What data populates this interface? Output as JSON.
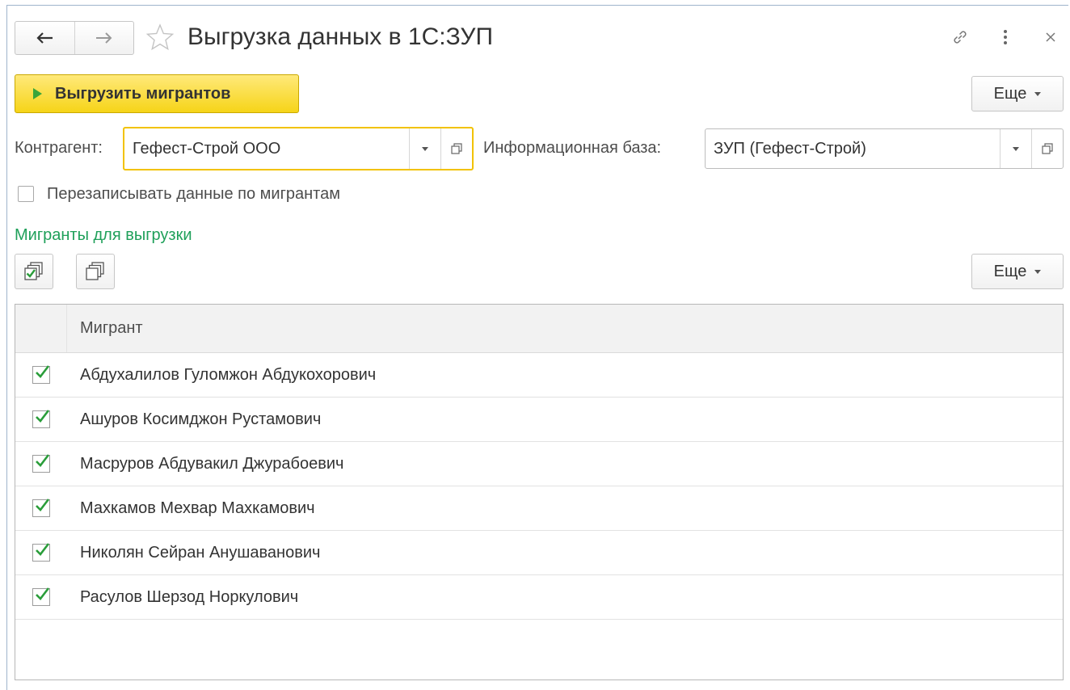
{
  "window": {
    "title": "Выгрузка данных в 1С:ЗУП"
  },
  "toolbar": {
    "export_label": "Выгрузить мигрантов",
    "more_label": "Еще"
  },
  "form": {
    "counterparty_label": "Контрагент:",
    "counterparty_value": "Гефест-Строй ООО",
    "infobase_label": "Информационная база:",
    "infobase_value": "ЗУП (Гефест-Строй)",
    "overwrite_label": "Перезаписывать данные по мигрантам",
    "overwrite_checked": false
  },
  "migrants_section": {
    "title": "Мигранты для выгрузки",
    "more_label": "Еще",
    "column_header": "Мигрант",
    "rows": [
      {
        "name": "Абдухалилов Гуломжон Абдукохорович",
        "checked": true
      },
      {
        "name": "Ашуров Косимджон Рустамович",
        "checked": true
      },
      {
        "name": "Масруров Абдувакил Джурабоевич",
        "checked": true
      },
      {
        "name": "Махкамов Мехвар Махкамович",
        "checked": true
      },
      {
        "name": "Николян Сейран Анушаванович",
        "checked": true
      },
      {
        "name": "Расулов Шерзод Норкулович",
        "checked": true
      }
    ]
  },
  "colors": {
    "accent_yellow": "#f6d418",
    "section_green": "#1fa05a",
    "check_green": "#2a9d3a"
  }
}
